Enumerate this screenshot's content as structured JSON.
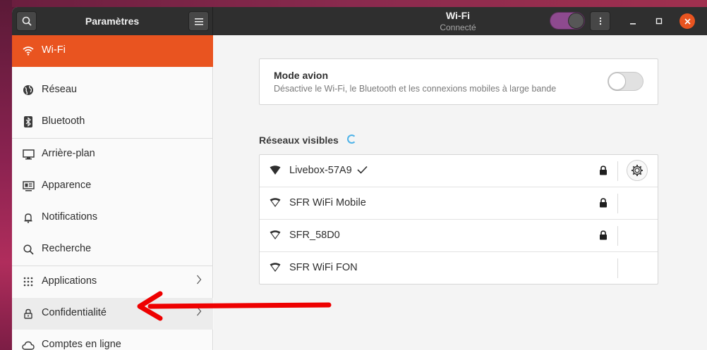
{
  "header": {
    "sidebar_title": "Paramètres",
    "title": "Wi-Fi",
    "subtitle": "Connecté",
    "wifi_enabled": true
  },
  "sidebar": {
    "items": [
      {
        "label": "Wi-Fi",
        "icon": "wifi-icon",
        "active": true
      },
      {
        "label": "Réseau",
        "icon": "globe-icon"
      },
      {
        "label": "Bluetooth",
        "icon": "bluetooth-icon"
      },
      {
        "label": "Arrière-plan",
        "icon": "monitor-icon"
      },
      {
        "label": "Apparence",
        "icon": "appearance-icon"
      },
      {
        "label": "Notifications",
        "icon": "bell-icon"
      },
      {
        "label": "Recherche",
        "icon": "search-icon"
      },
      {
        "label": "Applications",
        "icon": "grid-icon",
        "has_submenu": true
      },
      {
        "label": "Confidentialité",
        "icon": "lock-icon",
        "has_submenu": true
      },
      {
        "label": "Comptes en ligne",
        "icon": "cloud-icon"
      }
    ]
  },
  "airplane": {
    "title": "Mode avion",
    "description": "Désactive le Wi-Fi, le Bluetooth et les connexions mobiles à large bande",
    "enabled": false
  },
  "networks": {
    "section_title": "Réseaux visibles",
    "items": [
      {
        "name": "Livebox-57A9",
        "connected": true,
        "secured": true
      },
      {
        "name": "SFR WiFi Mobile",
        "connected": false,
        "secured": true
      },
      {
        "name": "SFR_58D0",
        "connected": false,
        "secured": true
      },
      {
        "name": "SFR WiFi FON",
        "connected": false,
        "secured": false
      }
    ]
  },
  "colors": {
    "accent": "#e95420",
    "header_bg": "#2f2f2f",
    "switch_on": "#8e4a8f",
    "annotation_arrow": "#ee0000"
  }
}
